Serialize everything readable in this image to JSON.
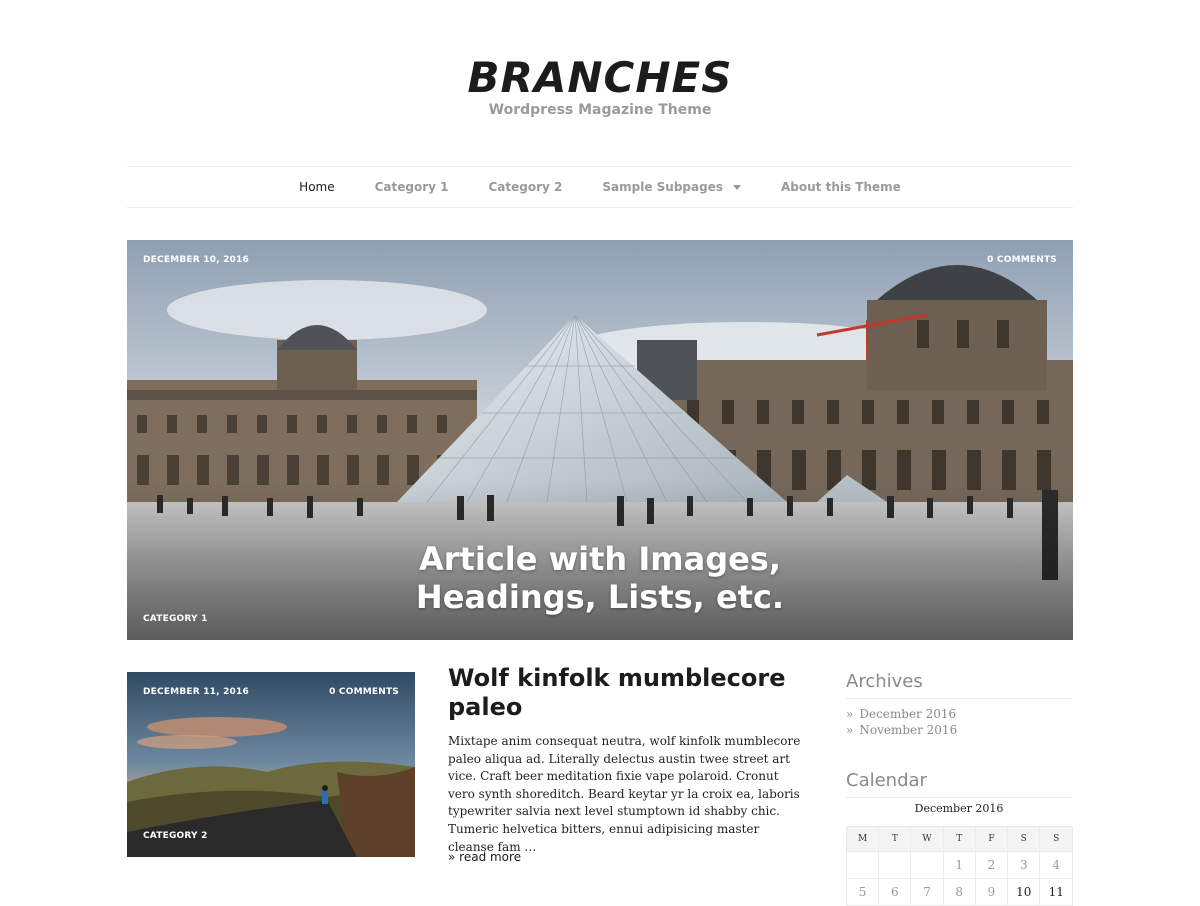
{
  "site": {
    "title": "BRANCHES",
    "description": "Wordpress Magazine Theme"
  },
  "nav": {
    "items": [
      {
        "label": "Home",
        "active": true
      },
      {
        "label": "Category 1"
      },
      {
        "label": "Category 2"
      },
      {
        "label": "Sample Subpages",
        "has_submenu": true
      },
      {
        "label": "About this Theme"
      }
    ]
  },
  "hero": {
    "date": "DECEMBER 10, 2016",
    "comments": "0 COMMENTS",
    "category": "CATEGORY 1",
    "title_line1": "Article with Images,",
    "title_line2": "Headings, Lists, etc."
  },
  "post": {
    "date": "DECEMBER 11, 2016",
    "comments": "0 COMMENTS",
    "category": "CATEGORY 2",
    "title": "Wolf kinfolk mumblecore paleo",
    "excerpt": "Mixtape anim consequat neutra, wolf kinfolk mumblecore paleo aliqua ad. Literally delectus austin twee street art vice. Craft beer meditation fixie vape polaroid. Cronut vero synth shoreditch. Beard keytar yr la croix ea, laboris typewriter salvia next level stumptown id shabby chic. Tumeric helvetica bitters, ennui adipisicing master cleanse fam …",
    "read_more": "» read more"
  },
  "sidebar": {
    "archives_title": "Archives",
    "archives": [
      {
        "bullet": "»",
        "label": "December 2016"
      },
      {
        "bullet": "»",
        "label": "November 2016"
      }
    ],
    "calendar_title": "Calendar",
    "calendar_caption": "December 2016",
    "weekdays": [
      "M",
      "T",
      "W",
      "T",
      "F",
      "S",
      "S"
    ],
    "row1": [
      "",
      "",
      "",
      "1",
      "2",
      "3",
      "4"
    ],
    "row2": [
      "5",
      "6",
      "7",
      "8",
      "9",
      "10",
      "11"
    ]
  },
  "colors": {
    "text_dark": "#1c1c1c",
    "text_muted": "#9a9a9a",
    "border": "#ececec"
  }
}
